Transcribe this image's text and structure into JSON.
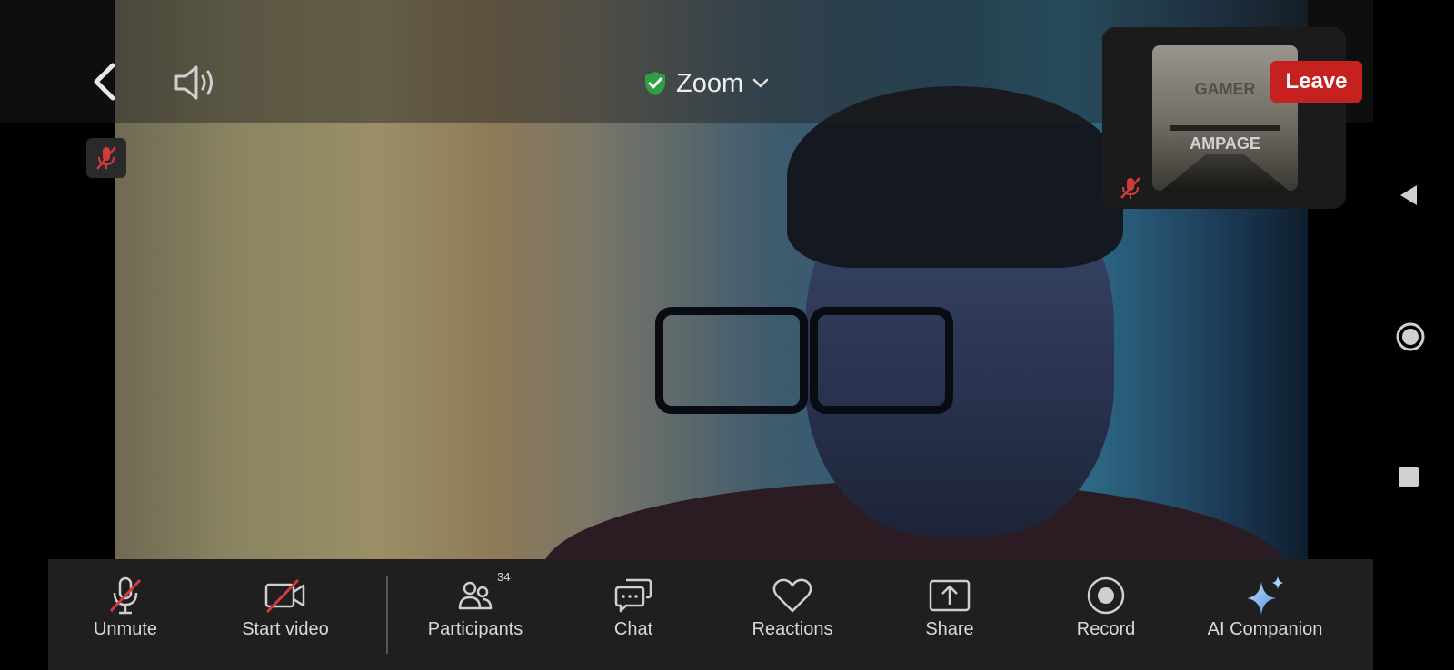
{
  "header": {
    "title": "Zoom",
    "leave_label": "Leave",
    "security_color": "#2ea043",
    "leave_color": "#c6201f"
  },
  "self_view": {
    "thumbnail_text_top": "GAMER",
    "thumbnail_text_bottom": "AMPAGE"
  },
  "toolbar": {
    "unmute_label": "Unmute",
    "start_video_label": "Start video",
    "participants_label": "Participants",
    "participants_count": "34",
    "chat_label": "Chat",
    "reactions_label": "Reactions",
    "share_label": "Share",
    "record_label": "Record",
    "ai_companion_label": "AI Companion"
  },
  "icons": {
    "back": "chevron-left-icon",
    "speaker": "speaker-icon",
    "security": "shield-check-icon",
    "dropdown": "chevron-down-icon",
    "muted": "mic-off-icon",
    "video_off": "video-off-icon",
    "participants": "people-icon",
    "chat": "chat-icon",
    "reactions": "heart-icon",
    "share": "share-icon",
    "record": "record-icon",
    "ai": "sparkle-icon",
    "nav_back": "triangle-back-icon",
    "nav_home": "circle-home-icon",
    "nav_recents": "square-recents-icon"
  }
}
